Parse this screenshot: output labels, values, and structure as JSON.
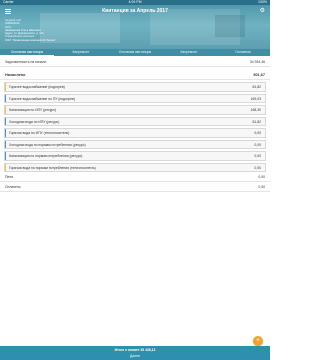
{
  "status_bar": {
    "carrier": "Carrier",
    "time": "4:09 PM",
    "battery": "100%"
  },
  "header": {
    "title": "Квитанция за Апрель 2017",
    "info": [
      "Лицевой счёт",
      "0100001610",
      "ФИО",
      "Шаповалова Ольга Ивановна",
      "Адрес: ул. Дзержинского, д. 123",
      "Управляющая компания",
      "ООО \"Управляющая компания 21 Регион\""
    ]
  },
  "tabs": [
    "Основная квитанция",
    "Капремонт",
    "Основная квитанция",
    "Капремонт",
    "Основная"
  ],
  "summary": {
    "debt_label": "Задолженность на начало",
    "debt_value": "34 934,46",
    "accrued_label": "Начислено",
    "accrued_value": "501,67"
  },
  "services": [
    {
      "label": "Горячее водоснабжение (подогрев)",
      "value": "81,82",
      "color": "#f5c242"
    },
    {
      "label": "Горячее водоснабжение по ПУ (подогрев)",
      "value": "169,03",
      "color": "#4a90d9"
    },
    {
      "label": "Канализация по ИПУ (ресурс)",
      "value": "168,30",
      "color": "#f5c242"
    },
    {
      "label": "Холодная вода по ИПУ (ресурс)",
      "value": "81,82",
      "color": "#4a90d9"
    },
    {
      "label": "Горячая вода по ИПУ (теплоноситель)",
      "value": "0,00",
      "color": "#4a90d9"
    },
    {
      "label": "Холодная вода по нормам потребления (ресурс)",
      "value": "0,00",
      "color": "#4a90d9"
    },
    {
      "label": "Канализация по нормам потребления (ресурс)",
      "value": "0,00",
      "color": "#4a90d9"
    },
    {
      "label": "Горячая вода по нормам потребления (теплоноситель)",
      "value": "0,00",
      "color": "#f5c242"
    }
  ],
  "extra": [
    {
      "label": "Пени",
      "value": "0,00"
    },
    {
      "label": "Оплачено",
      "value": "0,00"
    }
  ],
  "footer": {
    "total": "Итого к оплате 35 436,13",
    "pay": "Далее"
  }
}
